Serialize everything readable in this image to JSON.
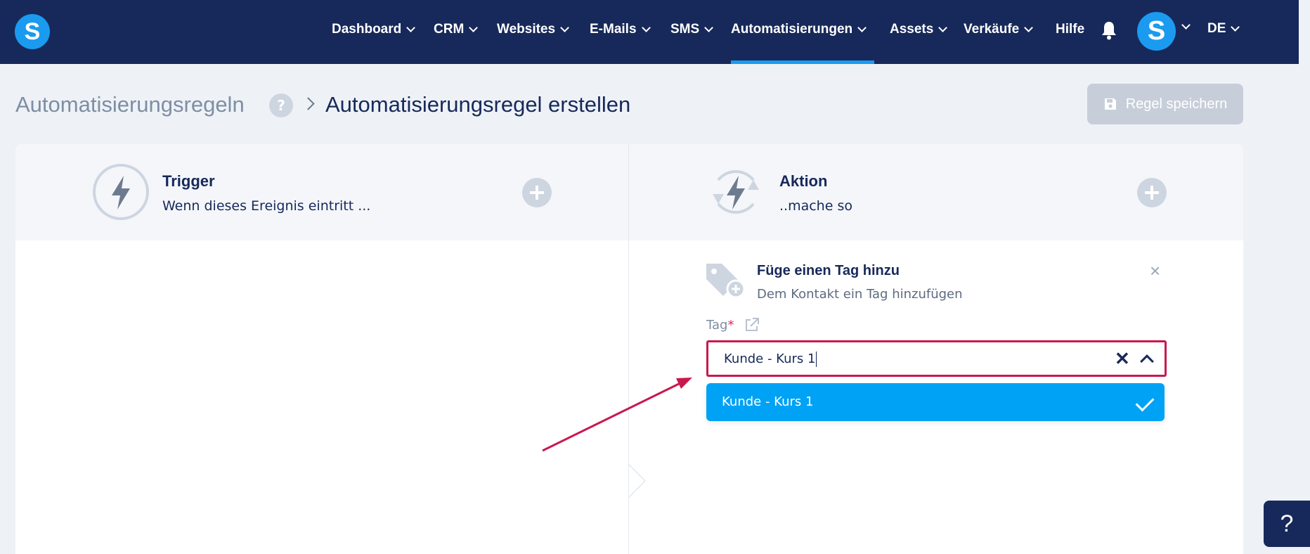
{
  "brand": {
    "logo_letter": "S"
  },
  "nav": {
    "items": [
      {
        "label": "Dashboard"
      },
      {
        "label": "CRM"
      },
      {
        "label": "Websites"
      },
      {
        "label": "E-Mails"
      },
      {
        "label": "SMS"
      },
      {
        "label": "Automatisierungen"
      },
      {
        "label": "Assets"
      },
      {
        "label": "Verkäufe"
      },
      {
        "label": "Hilfe"
      }
    ],
    "active": "Automatisierungen",
    "avatar_letter": "S",
    "language": "DE"
  },
  "breadcrumb": {
    "parent": "Automatisierungsregeln",
    "help": "?",
    "current": "Automatisierungsregel erstellen"
  },
  "toolbar": {
    "save_label": "Regel speichern"
  },
  "trigger": {
    "title": "Trigger",
    "subtitle": "Wenn dieses Ereignis eintritt ..."
  },
  "action": {
    "title": "Aktion",
    "subtitle": "..mache so"
  },
  "action_card": {
    "title": "Füge einen Tag hinzu",
    "subtitle": "Dem Kontakt ein Tag hinzufügen",
    "close": "×",
    "field_label": "Tag",
    "required_mark": "*",
    "value": "Kunde - Kurs 1",
    "clear": "✕",
    "options": [
      {
        "label": "Kunde - Kurs 1",
        "selected": true
      }
    ]
  },
  "help_fab": "?",
  "colors": {
    "nav_bg": "#17295a",
    "accent": "#1a9bf0",
    "option_bg": "#00a2f5",
    "highlight": "#c8194e"
  }
}
